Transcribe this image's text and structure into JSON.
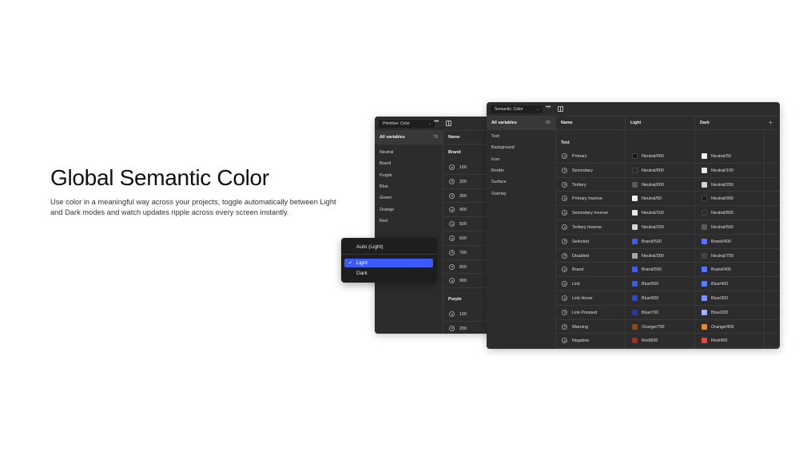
{
  "hero": {
    "title": "Global Semantic Color",
    "description": "Use color in a meaningful way across your projects, toggle automatically between Light and Dark modes and watch updates ripple across every screen instantly."
  },
  "primitive_panel": {
    "collection": "Primitive: Color",
    "all_variables_label": "All variables",
    "all_variables_count": "79",
    "groups": [
      "Neutral",
      "Brand",
      "Purple",
      "Blue",
      "Green",
      "Orange",
      "Red"
    ],
    "name_header": "Name",
    "brand_label": "Brand",
    "brand_steps": [
      "100",
      "200",
      "300",
      "400",
      "500",
      "600",
      "700",
      "800",
      "900"
    ],
    "purple_label": "Purple",
    "purple_steps": [
      "100",
      "200"
    ]
  },
  "semantic_panel": {
    "collection": "Semantic: Color",
    "all_variables_label": "All variables",
    "all_variables_count": "90",
    "groups": [
      "Text",
      "Background",
      "Icon",
      "Border",
      "Surface",
      "Overlay"
    ],
    "headers": {
      "name": "Name",
      "light": "Light",
      "dark": "Dark",
      "add": "+"
    },
    "section_label": "Text",
    "rows": [
      {
        "name": "Primary",
        "light": "Neutral/900",
        "light_color": "#1a1a1a",
        "dark": "Neutral/50",
        "dark_color": "#f2f2f2"
      },
      {
        "name": "Secondary",
        "light": "Neutral/800",
        "light_color": "#2a2a2a",
        "dark": "Neutral/100",
        "dark_color": "#e8e8e8"
      },
      {
        "name": "Tertiary",
        "light": "Neutral/600",
        "light_color": "#5a5a5a",
        "dark": "Neutral/200",
        "dark_color": "#d4d4d4"
      },
      {
        "name": "Primary Inverse",
        "light": "Neutral/50",
        "light_color": "#f2f2f2",
        "dark": "Neutral/900",
        "dark_color": "#1a1a1a"
      },
      {
        "name": "Secondary Inverse",
        "light": "Neutral/100",
        "light_color": "#e8e8e8",
        "dark": "Neutral/800",
        "dark_color": "#2a2a2a"
      },
      {
        "name": "Tertiary Inverse",
        "light": "Neutral/200",
        "light_color": "#d4d4d4",
        "dark": "Neutral/600",
        "dark_color": "#5a5a5a"
      },
      {
        "name": "Selected",
        "light": "Brand/500",
        "light_color": "#3d5afe",
        "dark": "Brand/400",
        "dark_color": "#5a72ff"
      },
      {
        "name": "Disabled",
        "light": "Neutral/300",
        "light_color": "#a8a8a8",
        "dark": "Neutral/700",
        "dark_color": "#444444"
      },
      {
        "name": "Brand",
        "light": "Brand/500",
        "light_color": "#3d5afe",
        "dark": "Brand/400",
        "dark_color": "#5a72ff"
      },
      {
        "name": "Link",
        "light": "Blue/500",
        "light_color": "#3b5bdb",
        "dark": "Blue/400",
        "dark_color": "#5c7cfa"
      },
      {
        "name": "Link Hover",
        "light": "Blue/600",
        "light_color": "#2f49c4",
        "dark": "Blue/300",
        "dark_color": "#7b93fb"
      },
      {
        "name": "Link Pressed",
        "light": "Blue/700",
        "light_color": "#2639a6",
        "dark": "Blue/200",
        "dark_color": "#a3b4fc"
      },
      {
        "name": "Warning",
        "light": "Orange/700",
        "light_color": "#8a4a12",
        "dark": "Orange/400",
        "dark_color": "#e08a3c"
      },
      {
        "name": "Negative",
        "light": "Red/600",
        "light_color": "#b3261e",
        "dark": "Red/400",
        "dark_color": "#e0483d"
      }
    ]
  },
  "mode_menu": {
    "options": [
      "Auto (Light)",
      "Light",
      "Dark"
    ],
    "selected": "Light"
  }
}
